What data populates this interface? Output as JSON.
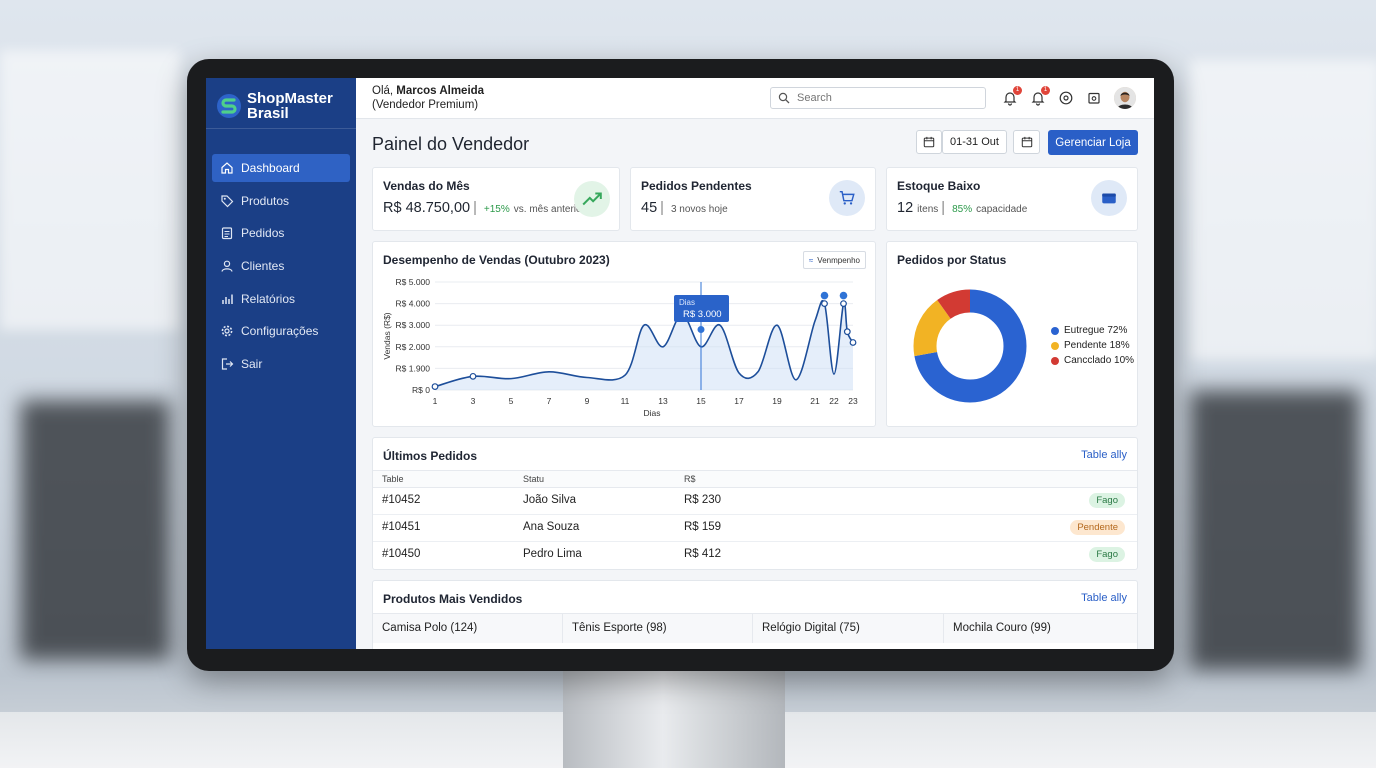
{
  "brand": {
    "name_line1": "ShopMaster",
    "name_line2": "Brasil"
  },
  "sidebar": {
    "items": [
      {
        "label": "Dashboard",
        "icon": "home-icon",
        "active": true
      },
      {
        "label": "Produtos",
        "icon": "tag-icon"
      },
      {
        "label": "Pedidos",
        "icon": "clipboard-icon"
      },
      {
        "label": "Clientes",
        "icon": "user-icon"
      },
      {
        "label": "Relatórios",
        "icon": "bar-chart-icon"
      },
      {
        "label": "Configurações",
        "icon": "gear-icon"
      },
      {
        "label": "Sair",
        "icon": "logout-icon"
      }
    ]
  },
  "header": {
    "greeting_prefix": "Olá,",
    "user_name": "Marcos Almeida",
    "user_role": "(Vendedor Premium)",
    "search_placeholder": "Search",
    "notification_badges": [
      "1",
      "1"
    ]
  },
  "page": {
    "title": "Painel do Vendedor",
    "date_range": "01-31 Out",
    "manage_button": "Gerenciar Loja"
  },
  "kpis": [
    {
      "title": "Vendas do Mês",
      "value": "R$ 48.750,00",
      "delta": "+15%",
      "note": "vs. mês anterior",
      "icon": "trend-up-icon"
    },
    {
      "title": "Pedidos Pendentes",
      "value": "45",
      "note": "3 novos hoje",
      "icon": "cart-icon"
    },
    {
      "title": "Estoque Baixo",
      "value": "12",
      "unit": "itens",
      "delta": "85%",
      "note": "capacidade",
      "icon": "box-icon"
    }
  ],
  "sales_chart": {
    "title": "Desempenho de Vendas (Outubro 2023)",
    "legend_label": "Venmpenho",
    "tooltip_label": "Dias",
    "tooltip_value": "R$ 3.000",
    "colors": {
      "line": "#1d4e9a",
      "fill": "#cfe0f6",
      "marker": "#2f73d6"
    }
  },
  "chart_data": [
    {
      "type": "line",
      "title": "Desempenho de Vendas (Outubro 2023)",
      "xlabel": "Dias",
      "ylabel": "Vendas (R$)",
      "x_ticks": [
        "1",
        "3",
        "5",
        "7",
        "9",
        "11",
        "13",
        "15",
        "17",
        "19",
        "21",
        "22",
        "23"
      ],
      "y_ticks": [
        "R$ 0",
        "R$ 1.900",
        "R$ 2.000",
        "R$ 3.000",
        "R$ 4.000",
        "R$ 5.000"
      ],
      "series": [
        {
          "points": [
            [
              "1",
              300
            ],
            [
              "3",
              1200
            ],
            [
              "5",
              1000
            ],
            [
              "7",
              1600
            ],
            [
              "9",
              1100
            ],
            [
              "11",
              1300
            ],
            [
              "12",
              3000
            ],
            [
              "13",
              2000
            ],
            [
              "14",
              3500
            ],
            [
              "15",
              2000
            ],
            [
              "16",
              3000
            ],
            [
              "17",
              1500
            ],
            [
              "18",
              1600
            ],
            [
              "19",
              3000
            ],
            [
              "20",
              900
            ],
            [
              "21",
              3200
            ],
            [
              "21.5",
              4000
            ],
            [
              "22",
              1400
            ],
            [
              "22.5",
              4000
            ],
            [
              "22.7",
              2700
            ],
            [
              "23",
              2200
            ]
          ]
        }
      ],
      "highlight": {
        "x": "15",
        "label": "Dias",
        "value": "R$ 3.000"
      }
    },
    {
      "type": "pie",
      "title": "Pedidos por Status",
      "categories": [
        "Eutregue",
        "Pendente",
        "Cancclado"
      ],
      "values": [
        72,
        18,
        10
      ],
      "legend": [
        "Eutregue 72%",
        "Pendente 18%",
        "Cancclado 10%"
      ],
      "colors": [
        "#2a63d1",
        "#f2b324",
        "#d23a33"
      ]
    }
  ],
  "recent_orders": {
    "title": "Últimos Pedidos",
    "link": "Table ally",
    "columns": [
      "Table",
      "Statu",
      "R$"
    ],
    "rows": [
      {
        "id": "#10452",
        "customer": "João Silva",
        "amount": "R$ 230",
        "status": "Fago"
      },
      {
        "id": "#10451",
        "customer": "Ana Souza",
        "amount": "R$ 159",
        "status": "Pendente"
      },
      {
        "id": "#10450",
        "customer": "Pedro Lima",
        "amount": "R$ 412",
        "status": "Fago"
      }
    ]
  },
  "top_products": {
    "title": "Produtos Mais Vendidos",
    "link": "Table ally",
    "items": [
      "Camisa Polo (124)",
      "Tênis Esporte (98)",
      "Relógio Digital (75)",
      "Mochila Couro (99)"
    ]
  }
}
